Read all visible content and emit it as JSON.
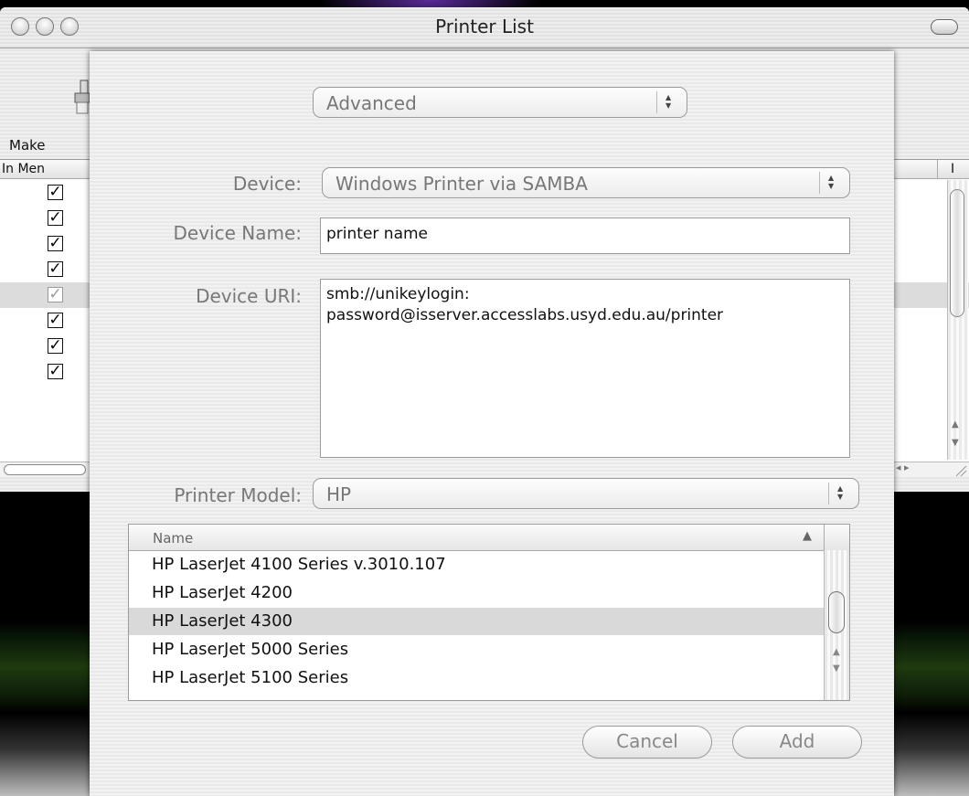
{
  "window": {
    "title": "Printer List",
    "toolbar": {
      "make_label": "Make"
    },
    "list": {
      "header_in_menu": "In Men",
      "header_right": "I",
      "rows": [
        {
          "checked": true,
          "selected": false
        },
        {
          "checked": true,
          "selected": false
        },
        {
          "checked": true,
          "selected": false
        },
        {
          "checked": true,
          "selected": false
        },
        {
          "checked": true,
          "selected": true
        },
        {
          "checked": true,
          "selected": false
        },
        {
          "checked": true,
          "selected": false
        },
        {
          "checked": true,
          "selected": false
        }
      ]
    }
  },
  "sheet": {
    "mode_popup": "Advanced",
    "device_label": "Device:",
    "device_value": "Windows Printer via SAMBA",
    "device_name_label": "Device Name:",
    "device_name_value": "printer name",
    "device_uri_label": "Device URI:",
    "device_uri_value": "smb://unikeylogin:\npassword@isserver.accesslabs.usyd.edu.au/printer",
    "printer_model_label": "Printer Model:",
    "printer_model_value": "HP",
    "model_table": {
      "column_header": "Name",
      "rows": [
        {
          "name": "HP LaserJet 4100 Series v.3010.107",
          "selected": false
        },
        {
          "name": "HP LaserJet 4200",
          "selected": false
        },
        {
          "name": "HP LaserJet 4300",
          "selected": true
        },
        {
          "name": "HP LaserJet 5000 Series",
          "selected": false
        },
        {
          "name": "HP LaserJet 5100 Series",
          "selected": false
        }
      ]
    },
    "cancel_label": "Cancel",
    "add_label": "Add"
  },
  "colors": {
    "window_bg": "#ececec",
    "selected_row": "#dcdcdc",
    "disabled_text": "#777777"
  }
}
